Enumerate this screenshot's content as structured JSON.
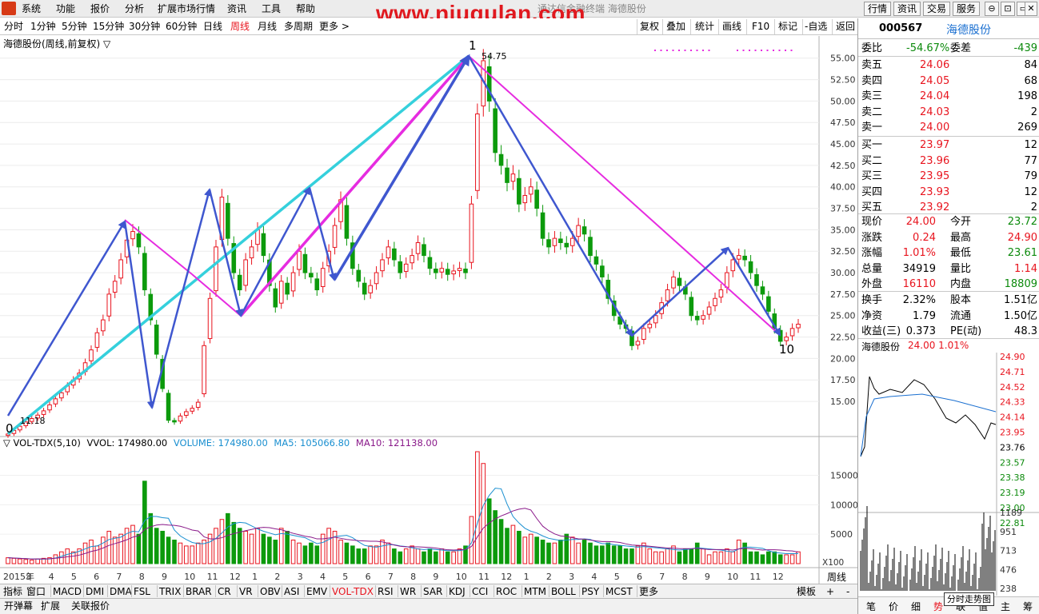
{
  "menubar": {
    "items": [
      "系统",
      "功能",
      "报价",
      "分析",
      "扩展市场行情",
      "资讯",
      "工具",
      "帮助"
    ],
    "watermark": "www.niugulan.com",
    "window_title": "通达信金融终端  海德股份",
    "right_buttons": [
      "行情",
      "资讯",
      "交易",
      "服务"
    ],
    "win_controls": [
      "⊖",
      "⊡",
      "▭",
      "✕"
    ]
  },
  "periodbar": {
    "periods": [
      "分时",
      "1分钟",
      "5分钟",
      "15分钟",
      "30分钟",
      "60分钟",
      "日线",
      "周线",
      "月线",
      "多周期",
      "更多 >"
    ],
    "active": "周线",
    "tools": [
      "复权",
      "叠加",
      "统计",
      "画线",
      "F10",
      "标记",
      "-自选",
      "返回"
    ]
  },
  "chart": {
    "title": "海德股份(周线,前复权) ▽",
    "annotations": {
      "start_label": "0",
      "peak_label": "1",
      "end_label": "10",
      "low_value": "11.18",
      "high_value": "54.75"
    }
  },
  "chart_data": [
    {
      "type": "candlestick",
      "title": "海德股份(周线,前复权)",
      "ylim": [
        11,
        56
      ],
      "y_ticks": [
        "55.00",
        "52.50",
        "50.00",
        "47.50",
        "45.00",
        "42.50",
        "40.00",
        "37.50",
        "35.00",
        "32.50",
        "30.00",
        "27.50",
        "25.00",
        "22.50",
        "20.00",
        "17.50",
        "15.00"
      ],
      "x_tick_labels": [
        "2015年",
        "3",
        "4",
        "5",
        "6",
        "7",
        "8",
        "9",
        "10",
        "11",
        "12",
        "1",
        "2",
        "3",
        "4",
        "5",
        "6",
        "7",
        "8",
        "9",
        "10",
        "11",
        "12",
        "1",
        "2",
        "3",
        "4",
        "5",
        "6",
        "7",
        "8",
        "9",
        "10",
        "11",
        "12"
      ],
      "x_ticks": [
        "2015年",
        "3",
        "4",
        "5",
        "6",
        "",
        "9",
        "10",
        "11",
        "12",
        "1",
        "2",
        "3",
        "4",
        "5",
        "6",
        "7",
        "8",
        "9",
        "10",
        "11",
        "12",
        "1",
        "2",
        "3",
        "4",
        "5",
        "6",
        "7",
        "8",
        "9",
        "10",
        "11",
        "12"
      ],
      "close_series": [
        11.2,
        11.6,
        12.1,
        12.6,
        13.0,
        13.4,
        13.9,
        14.6,
        15.3,
        16.0,
        16.8,
        17.5,
        18.3,
        19.5,
        21.0,
        23.0,
        24.5,
        27.5,
        29.0,
        31.5,
        33.8,
        34.8,
        33.0,
        28.0,
        24.5,
        20.5,
        16.5,
        12.8,
        12.6,
        13.3,
        13.8,
        14.2,
        14.9,
        21.5,
        27.0,
        33.0,
        38.8,
        34.0,
        30.0,
        28.0,
        31.5,
        33.0,
        35.0,
        32.0,
        28.5,
        26.0,
        29.0,
        27.5,
        30.0,
        32.5,
        30.0,
        29.5,
        28.0,
        30.5,
        32.5,
        35.5,
        38.5,
        34.0,
        30.5,
        29.0,
        27.5,
        28.5,
        30.0,
        31.5,
        33.0,
        31.5,
        30.0,
        31.0,
        32.0,
        33.5,
        32.0,
        30.5,
        30.0,
        30.5,
        29.8,
        30.2,
        30.5,
        30.0,
        38.0,
        48.5,
        54.7,
        50.0,
        44.0,
        42.5,
        40.5,
        41.5,
        38.0,
        39.0,
        40.0,
        37.5,
        34.0,
        33.0,
        34.0,
        33.5,
        33.0,
        34.0,
        35.5,
        34.5,
        32.0,
        31.0,
        29.5,
        27.0,
        25.0,
        24.0,
        23.5,
        21.5,
        22.0,
        23.5,
        24.0,
        25.0,
        26.5,
        28.0,
        29.5,
        28.5,
        27.5,
        25.0,
        24.5,
        25.0,
        26.0,
        27.0,
        28.0,
        30.0,
        31.5,
        32.0,
        31.5,
        30.0,
        28.5,
        27.5,
        25.5,
        23.5,
        22.0,
        22.5,
        23.5,
        24.0
      ],
      "high_value": 54.75,
      "low_value": 11.18,
      "pattern_points": {
        "0": "11.18",
        "1": "54.75",
        "10": "≈21.5"
      }
    },
    {
      "type": "bar",
      "title": "VOL-TDX(5,10)",
      "ylim": [
        0,
        19000
      ],
      "y_ticks": [
        "15000",
        "10000",
        "5000"
      ],
      "unit_label": "X100",
      "series": [
        {
          "name": "VOLUME",
          "last": "174980.00"
        },
        {
          "name": "MA5",
          "last": "105066.80"
        },
        {
          "name": "MA10",
          "last": "121138.00"
        }
      ],
      "values": [
        1000,
        900,
        800,
        700,
        600,
        800,
        900,
        1000,
        1500,
        2000,
        2500,
        2000,
        2500,
        3500,
        4000,
        3000,
        4500,
        5500,
        4500,
        5000,
        6000,
        6500,
        5000,
        14000,
        8500,
        6000,
        5500,
        4500,
        4000,
        3500,
        3000,
        3000,
        3500,
        4000,
        5000,
        6000,
        7500,
        8500,
        7000,
        6000,
        5500,
        5000,
        6000,
        5000,
        4500,
        4000,
        6000,
        5500,
        4000,
        3500,
        3000,
        3500,
        3000,
        5000,
        6000,
        5500,
        4000,
        3500,
        3000,
        2500,
        2500,
        3000,
        3000,
        4000,
        3500,
        2500,
        2000,
        2500,
        3000,
        2500,
        2000,
        2500,
        2000,
        2500,
        2000,
        2000,
        2500,
        3000,
        8000,
        19000,
        17000,
        11000,
        9000,
        7500,
        6000,
        6500,
        5500,
        4500,
        5000,
        4500,
        4000,
        3500,
        3500,
        4000,
        5000,
        4500,
        3500,
        4000,
        3500,
        3000,
        3000,
        3500,
        3000,
        3000,
        2500,
        2500,
        3000,
        3500,
        2500,
        2000,
        2000,
        2500,
        3000,
        2000,
        2500,
        2500,
        3500,
        2500,
        1500,
        2000,
        2000,
        2500,
        2000,
        4000,
        3500,
        2000,
        2000,
        1500,
        2000,
        2000,
        1500,
        1500,
        1500,
        2000
      ]
    }
  ],
  "volume_panel": {
    "label_indicator": "▽ VOL-TDX(5,10)",
    "label_vvol": "VVOL: 174980.00",
    "label_volume": "VOLUME: 174980.00",
    "label_ma5": "MA5: 105066.80",
    "label_ma10": "MA10: 121138.00",
    "unit": "X100",
    "period": "周线"
  },
  "indicator_tabs": [
    "指标",
    "窗口",
    "MACD",
    "DMI",
    "DMA",
    "FSL",
    "TRIX",
    "BRAR",
    "CR",
    "VR",
    "OBV",
    "ASI",
    "EMV",
    "VOL-TDX",
    "RSI",
    "WR",
    "SAR",
    "KDJ",
    "CCI",
    "ROC",
    "MTM",
    "BOLL",
    "PSY",
    "MCST",
    "更多"
  ],
  "indicator_active": "VOL-TDX",
  "indicator_right": [
    "模板",
    "+",
    "-"
  ],
  "statusbar": [
    "开弹幕",
    "扩展",
    "关联报价"
  ],
  "quote_panel": {
    "code": "000567",
    "name": "海德股份",
    "weibi_label": "委比",
    "weibi": "-54.67%",
    "weicha_label": "委差",
    "weicha": "-439",
    "asks": [
      {
        "label": "卖五",
        "price": "24.06",
        "vol": "84"
      },
      {
        "label": "卖四",
        "price": "24.05",
        "vol": "68"
      },
      {
        "label": "卖三",
        "price": "24.04",
        "vol": "198"
      },
      {
        "label": "卖二",
        "price": "24.03",
        "vol": "2"
      },
      {
        "label": "卖一",
        "price": "24.00",
        "vol": "269"
      }
    ],
    "bids": [
      {
        "label": "买一",
        "price": "23.97",
        "vol": "12"
      },
      {
        "label": "买二",
        "price": "23.96",
        "vol": "77"
      },
      {
        "label": "买三",
        "price": "23.95",
        "vol": "79"
      },
      {
        "label": "买四",
        "price": "23.93",
        "vol": "12"
      },
      {
        "label": "买五",
        "price": "23.92",
        "vol": "2"
      }
    ],
    "stats": [
      {
        "l1": "现价",
        "v1": "24.00",
        "c1": "red",
        "l2": "今开",
        "v2": "23.72",
        "c2": "green"
      },
      {
        "l1": "涨跌",
        "v1": "0.24",
        "c1": "red",
        "l2": "最高",
        "v2": "24.90",
        "c2": "red"
      },
      {
        "l1": "涨幅",
        "v1": "1.01%",
        "c1": "red",
        "l2": "最低",
        "v2": "23.61",
        "c2": "green"
      },
      {
        "l1": "总量",
        "v1": "34919",
        "c1": "blk",
        "l2": "量比",
        "v2": "1.14",
        "c2": "red"
      },
      {
        "l1": "外盘",
        "v1": "16110",
        "c1": "red",
        "l2": "内盘",
        "v2": "18809",
        "c2": "green"
      }
    ],
    "stats2": [
      {
        "l1": "换手",
        "v1": "2.32%",
        "l2": "股本",
        "v2": "1.51亿"
      },
      {
        "l1": "净资",
        "v1": "1.79",
        "l2": "流通",
        "v2": "1.50亿"
      },
      {
        "l1": "收益(三)",
        "v1": "0.373",
        "l2": "PE(动)",
        "v2": "48.3"
      }
    ]
  },
  "mini_chart": {
    "title_name": "海德股份",
    "title_price": "24.00 1.01%",
    "price_ticks": [
      "24.90",
      "24.71",
      "24.52",
      "24.33",
      "24.14",
      "23.95",
      "23.76",
      "23.57",
      "23.38",
      "23.19",
      "23.00",
      "22.81"
    ],
    "vol_ticks": [
      "1189",
      "951",
      "713",
      "476",
      "238"
    ],
    "tabs": [
      "笔",
      "价",
      "细",
      "势",
      "联",
      "值",
      "主",
      "筹"
    ],
    "tooltip": "分时走势图"
  }
}
